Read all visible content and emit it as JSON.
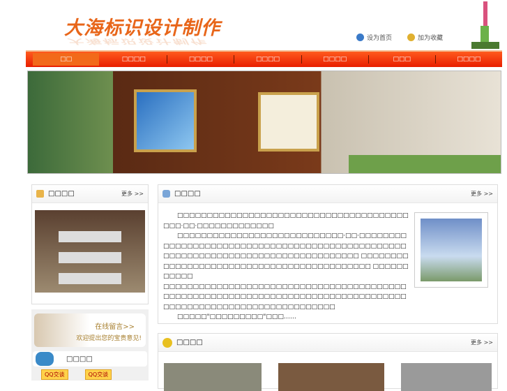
{
  "header": {
    "logo": "大海标识设计制作",
    "set_home": "设为首页",
    "add_fav": "加为收藏"
  },
  "nav": [
    "□□",
    "□□□□",
    "□□□□",
    "□□□□",
    "□□□□",
    "□□□",
    "□□□□"
  ],
  "panels": {
    "cases": {
      "title": "□□□□",
      "more": "更多 >>"
    },
    "about": {
      "title": "□□□□",
      "more": "更多 >>",
      "paragraphs": [
        "□□□□□□□□□□□□□□□□□□□□□□□□□□□□□□□□□□□□□□□□□□·□□·□□□□□□□□□□□□□",
        "□□□□□□□□□□□□□□□□□□□□□□□□□□□□·□□·□□□□□□□□□□□□□□□□□□□□□□□□□□□□□□□□□□□□□□□□□□□□□□□□□□□□□□□□□□□□□□□□□□□□□□□□□□□□□□□□□□ □□□□□□□□□□□□□□□□□□□□□□□□□□□□□□□□□□□□□□□□□□□ □□□□□□□□□□□",
        "□□□□□□□□□□□□□□□□□□□□□□□□□□□□□□□□□□□□□□□□□□□□□□□□□□□□□□□□□□□□□□□□□□□□□□□□□□□□□□□□□□□□□□□□□□□□□□□□□□□□□□□□□□□□□□□",
        "□□□□□\"□□□□□□□□□\"□□□……"
      ]
    },
    "message": {
      "title": "在线留言>>",
      "subtitle": "欢迎提出您的宝贵意见!"
    },
    "contact": {
      "title": "□□□□",
      "qq": "QQ交谈"
    },
    "products": {
      "title": "□□□□",
      "more": "更多 >>"
    }
  }
}
